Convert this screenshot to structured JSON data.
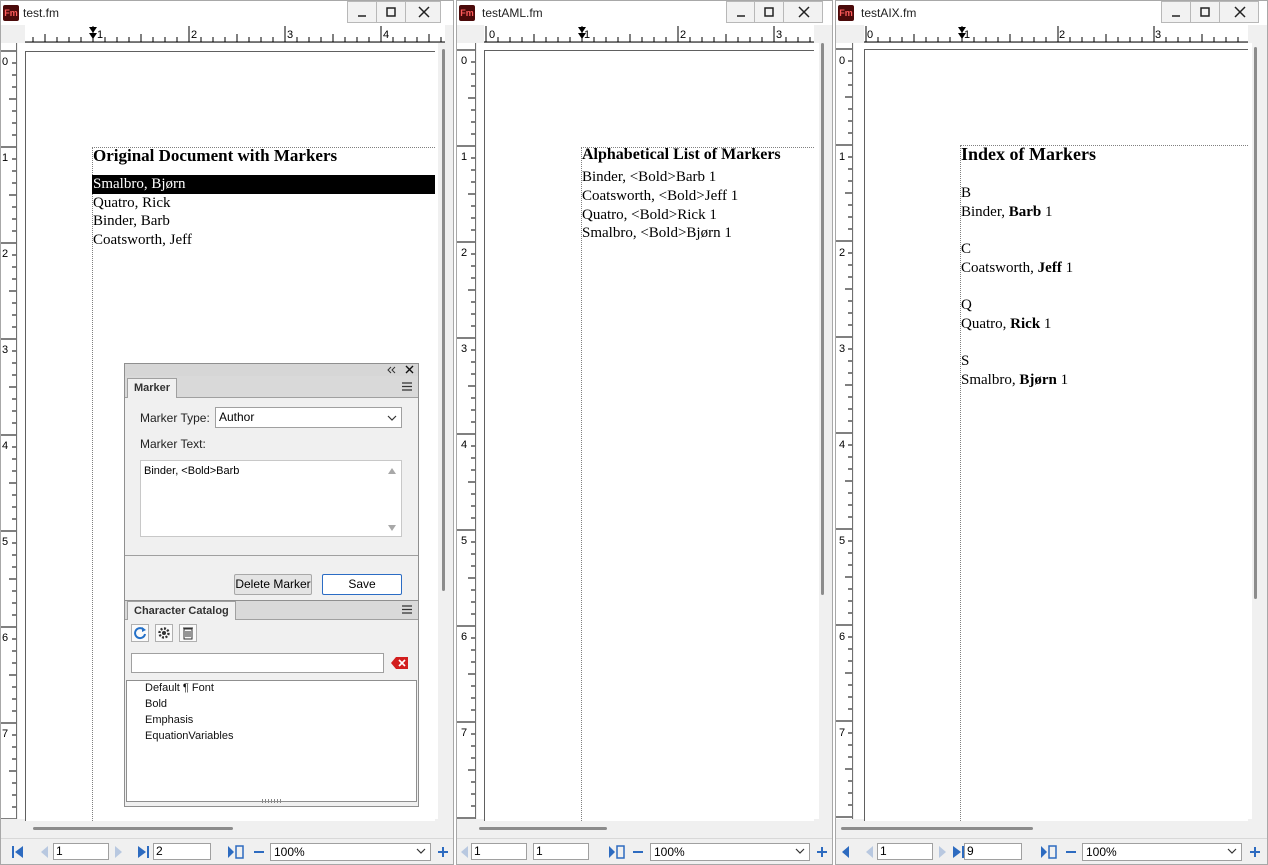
{
  "app_badge": "Fm",
  "windows": [
    {
      "title": "test.fm",
      "ruler_h": [
        "1",
        "2",
        "3",
        "4"
      ],
      "ruler_v": [
        "0",
        "1",
        "2",
        "3",
        "4",
        "5",
        "6",
        "7"
      ],
      "heading": "Original Document with Markers",
      "lines": [
        "Smalbro, Bjørn",
        "Quatro, Rick",
        "Binder, Barb",
        "Coatsworth, Jeff"
      ],
      "status": {
        "page": "1",
        "total": "2",
        "zoom": "100%"
      }
    },
    {
      "title": "testAML.fm",
      "ruler_h": [
        "0",
        "1",
        "2",
        "3"
      ],
      "ruler_v": [
        "0",
        "1",
        "2",
        "3",
        "4",
        "5",
        "6",
        "7"
      ],
      "heading": "Alphabetical List of Markers",
      "lines": [
        "Binder, <Bold>Barb 1",
        "Coatsworth, <Bold>Jeff 1",
        "Quatro, <Bold>Rick 1",
        "Smalbro, <Bold>Bjørn 1"
      ],
      "status": {
        "page": "1",
        "total": "1",
        "zoom": "100%"
      }
    },
    {
      "title": "testAIX.fm",
      "ruler_h": [
        "0",
        "1",
        "2",
        "3"
      ],
      "ruler_v": [
        "0",
        "1",
        "2",
        "3",
        "4",
        "5",
        "6",
        "7"
      ],
      "heading": "Index of Markers",
      "index_groups": [
        {
          "letter": "B",
          "name": "Binder, ",
          "bold": "Barb",
          "page": " 1"
        },
        {
          "letter": "C",
          "name": "Coatsworth, ",
          "bold": "Jeff",
          "page": " 1"
        },
        {
          "letter": "Q",
          "name": "Quatro, ",
          "bold": "Rick",
          "page": " 1"
        },
        {
          "letter": "S",
          "name": "Smalbro, ",
          "bold": "Bjørn",
          "page": " 1"
        }
      ],
      "status": {
        "page": "1",
        "total": "9",
        "zoom": "100%"
      }
    }
  ],
  "marker_panel": {
    "tab": "Marker",
    "type_label": "Marker Type:",
    "type_value": "Author",
    "text_label": "Marker Text:",
    "text_value": "Binder, <Bold>Barb",
    "delete_label": "Delete Marker",
    "save_label": "Save"
  },
  "char_catalog": {
    "tab": "Character Catalog",
    "search_value": "",
    "items": [
      "Default ¶ Font",
      "Bold",
      "Emphasis",
      "EquationVariables"
    ]
  }
}
